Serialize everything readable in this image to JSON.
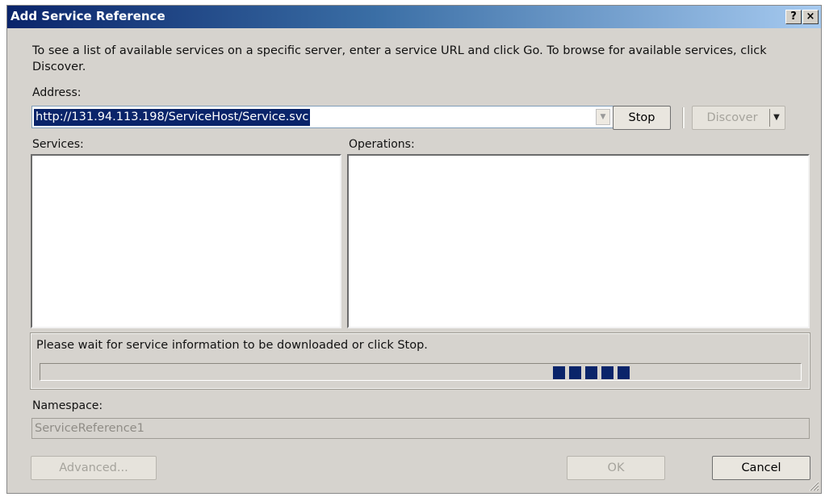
{
  "window": {
    "title": "Add Service Reference",
    "help_label": "?",
    "close_label": "×"
  },
  "intro_text": "To see a list of available services on a specific server, enter a service URL and click Go. To browse for available services, click Discover.",
  "address": {
    "label": "Address:",
    "value": "http://131.94.113.198/ServiceHost/Service.svc"
  },
  "buttons": {
    "stop": "Stop",
    "discover": "Discover",
    "advanced": "Advanced...",
    "ok": "OK",
    "cancel": "Cancel"
  },
  "services_label": "Services:",
  "operations_label": "Operations:",
  "status": {
    "message": "Please wait for service information to be downloaded or click Stop.",
    "progress_blocks": 5
  },
  "namespace": {
    "label": "Namespace:",
    "value": "ServiceReference1"
  },
  "colors": {
    "title_gradient_start": "#0a246a",
    "title_gradient_end": "#a6caf0",
    "dialog_face": "#d6d3ce",
    "selection": "#0a246a"
  }
}
